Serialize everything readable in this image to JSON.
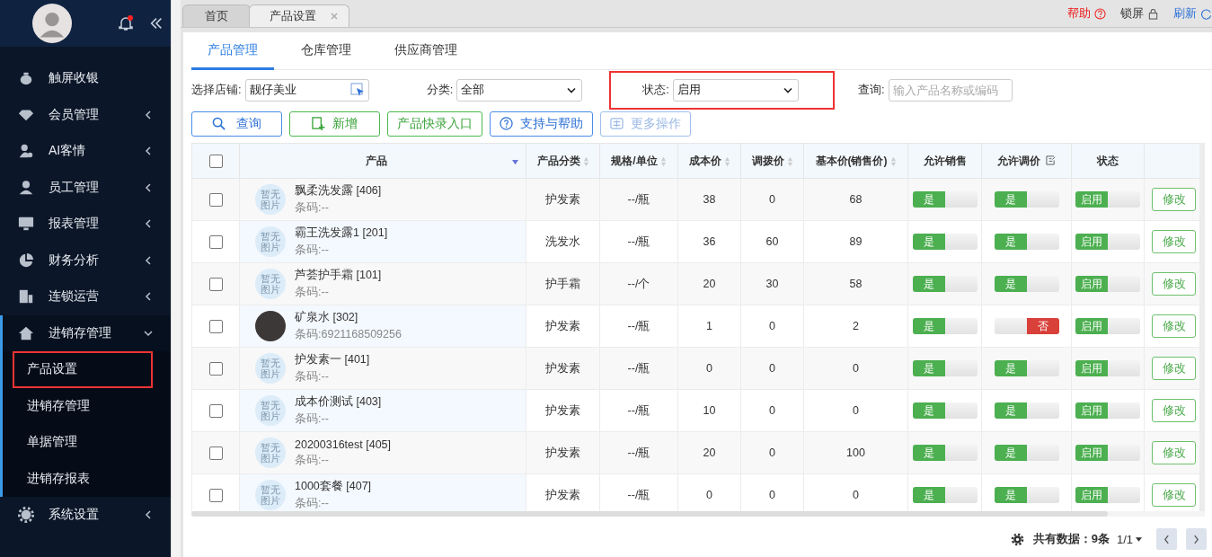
{
  "sidebar": {
    "items": [
      {
        "label": "触屏收银",
        "kind": "link",
        "expanded": false
      },
      {
        "label": "会员管理",
        "kind": "group",
        "expanded": false
      },
      {
        "label": "AI客情",
        "kind": "group",
        "expanded": false
      },
      {
        "label": "员工管理",
        "kind": "group",
        "expanded": false
      },
      {
        "label": "报表管理",
        "kind": "group",
        "expanded": false
      },
      {
        "label": "财务分析",
        "kind": "group",
        "expanded": false
      },
      {
        "label": "连锁运营",
        "kind": "group",
        "expanded": false
      },
      {
        "label": "进销存管理",
        "kind": "group",
        "expanded": true,
        "children": [
          {
            "label": "产品设置",
            "selected": true
          },
          {
            "label": "进销存管理",
            "selected": false
          },
          {
            "label": "单据管理",
            "selected": false
          },
          {
            "label": "进销存报表",
            "selected": false
          }
        ]
      },
      {
        "label": "系统设置",
        "kind": "group",
        "expanded": false
      }
    ],
    "notification": {
      "unread": true
    }
  },
  "page_tabs": [
    {
      "label": "首页",
      "selected": false,
      "closable": false
    },
    {
      "label": "产品设置",
      "selected": true,
      "closable": true
    }
  ],
  "toolbar": {
    "help": "帮助",
    "lock": "锁屏",
    "refresh": "刷新"
  },
  "sub_tabs": [
    {
      "label": "产品管理",
      "selected": true
    },
    {
      "label": "仓库管理",
      "selected": false
    },
    {
      "label": "供应商管理",
      "selected": false
    }
  ],
  "filters": {
    "store_label": "选择店铺:",
    "store_value": "靓仔美业",
    "category_label": "分类:",
    "category_value": "全部",
    "status_label": "状态:",
    "status_value": "启用",
    "status_highlighted": true,
    "query_label": "查询:",
    "query_placeholder": "输入产品名称或编码"
  },
  "buttons": [
    {
      "label": "查询",
      "kind": "blue"
    },
    {
      "label": "新增",
      "kind": "green"
    },
    {
      "label": "产品快录入口",
      "kind": "green"
    },
    {
      "label": "支持与帮助",
      "kind": "blue"
    },
    {
      "label": "更多操作",
      "kind": "faded"
    }
  ],
  "table": {
    "all_checked": false,
    "columns": [
      {
        "label": "产品",
        "sortable": false,
        "filterable": true
      },
      {
        "label": "产品分类",
        "sortable": true,
        "filterable": false
      },
      {
        "label": "规格/单位",
        "sortable": true,
        "filterable": false
      },
      {
        "label": "成本价",
        "sortable": true,
        "filterable": false
      },
      {
        "label": "调拨价",
        "sortable": true,
        "filterable": false
      },
      {
        "label": "基本价(销售价)",
        "sortable": true,
        "filterable": false
      },
      {
        "label": "允许销售",
        "sortable": false,
        "filterable": false
      },
      {
        "label": "允许调价",
        "sortable": false,
        "filterable": false
      },
      {
        "label": "状态",
        "sortable": false,
        "filterable": false
      }
    ],
    "rows": [
      {
        "checked": false,
        "image": {
          "kind": "placeholder",
          "text": "暂无图片"
        },
        "name": "飘柔洗发露 [406]",
        "barcode": "条码:--",
        "category": "护发素",
        "unit": "--/瓶",
        "cost": "38",
        "transfer": "0",
        "price": "68",
        "allow_sale": {
          "label": "是",
          "on": true
        },
        "allow_adjust": {
          "label": "是",
          "on": true
        },
        "status": {
          "label": "启用",
          "on": true
        },
        "action": "修改"
      },
      {
        "checked": false,
        "image": {
          "kind": "placeholder",
          "text": "暂无图片"
        },
        "name": "霸王洗发露1 [201]",
        "barcode": "条码:--",
        "category": "洗发水",
        "unit": "--/瓶",
        "cost": "36",
        "transfer": "60",
        "price": "89",
        "allow_sale": {
          "label": "是",
          "on": true
        },
        "allow_adjust": {
          "label": "是",
          "on": true
        },
        "status": {
          "label": "启用",
          "on": true
        },
        "action": "修改"
      },
      {
        "checked": false,
        "image": {
          "kind": "placeholder",
          "text": "暂无图片"
        },
        "name": "芦荟护手霜 [101]",
        "barcode": "条码:--",
        "category": "护手霜",
        "unit": "--/个",
        "cost": "20",
        "transfer": "30",
        "price": "58",
        "allow_sale": {
          "label": "是",
          "on": true
        },
        "allow_adjust": {
          "label": "是",
          "on": true
        },
        "status": {
          "label": "启用",
          "on": true
        },
        "action": "修改"
      },
      {
        "checked": false,
        "image": {
          "kind": "photo"
        },
        "name": "矿泉水 [302]",
        "barcode": "条码:6921168509256",
        "category": "护发素",
        "unit": "--/瓶",
        "cost": "1",
        "transfer": "0",
        "price": "2",
        "allow_sale": {
          "label": "是",
          "on": true
        },
        "allow_adjust": {
          "label": "否",
          "on": false
        },
        "status": {
          "label": "启用",
          "on": true
        },
        "action": "修改"
      },
      {
        "checked": false,
        "image": {
          "kind": "placeholder",
          "text": "暂无图片"
        },
        "name": "护发素一 [401]",
        "barcode": "条码:--",
        "category": "护发素",
        "unit": "--/瓶",
        "cost": "0",
        "transfer": "0",
        "price": "0",
        "allow_sale": {
          "label": "是",
          "on": true
        },
        "allow_adjust": {
          "label": "是",
          "on": true
        },
        "status": {
          "label": "启用",
          "on": true
        },
        "action": "修改"
      },
      {
        "checked": false,
        "image": {
          "kind": "placeholder",
          "text": "暂无图片"
        },
        "name": "成本价测试 [403]",
        "barcode": "条码:--",
        "category": "护发素",
        "unit": "--/瓶",
        "cost": "10",
        "transfer": "0",
        "price": "0",
        "allow_sale": {
          "label": "是",
          "on": true
        },
        "allow_adjust": {
          "label": "是",
          "on": true
        },
        "status": {
          "label": "启用",
          "on": true
        },
        "action": "修改"
      },
      {
        "checked": false,
        "image": {
          "kind": "placeholder",
          "text": "暂无图片"
        },
        "name": "20200316test [405]",
        "barcode": "条码:--",
        "category": "护发素",
        "unit": "--/瓶",
        "cost": "20",
        "transfer": "0",
        "price": "100",
        "allow_sale": {
          "label": "是",
          "on": true
        },
        "allow_adjust": {
          "label": "是",
          "on": true
        },
        "status": {
          "label": "启用",
          "on": true
        },
        "action": "修改"
      },
      {
        "checked": false,
        "image": {
          "kind": "placeholder",
          "text": "暂无图片"
        },
        "name": "1000套餐 [407]",
        "barcode": "条码:--",
        "category": "护发素",
        "unit": "--/瓶",
        "cost": "0",
        "transfer": "0",
        "price": "0",
        "allow_sale": {
          "label": "是",
          "on": true
        },
        "allow_adjust": {
          "label": "是",
          "on": true
        },
        "status": {
          "label": "启用",
          "on": true
        },
        "action": "修改"
      }
    ]
  },
  "footer": {
    "total": "共有数据：9条",
    "page": "1/1"
  }
}
